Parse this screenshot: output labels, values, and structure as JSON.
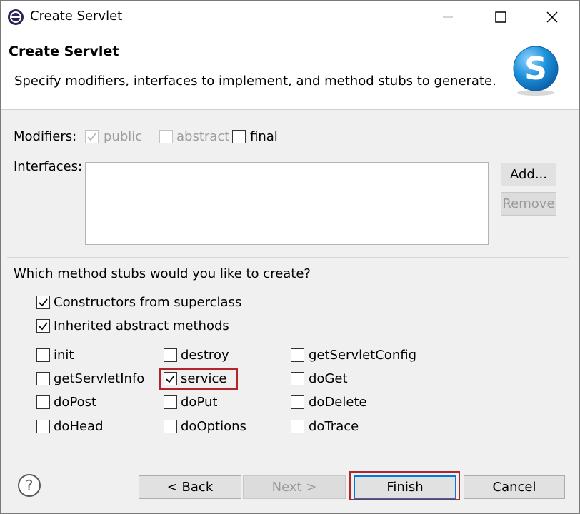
{
  "window": {
    "title": "Create Servlet"
  },
  "header": {
    "heading": "Create Servlet",
    "description": "Specify modifiers, interfaces to implement, and method stubs to generate."
  },
  "modifiers": {
    "label": "Modifiers:",
    "public": {
      "label": "public",
      "checked": true,
      "enabled": false
    },
    "abstract": {
      "label": "abstract",
      "checked": false,
      "enabled": false
    },
    "final": {
      "label": "final",
      "checked": false,
      "enabled": true
    }
  },
  "interfaces": {
    "label": "Interfaces:",
    "items": [],
    "add_label": "Add...",
    "remove_label": "Remove"
  },
  "stubs": {
    "question": "Which method stubs would you like to create?",
    "constructors": {
      "label": "Constructors from superclass",
      "checked": true
    },
    "inherited": {
      "label": "Inherited abstract methods",
      "checked": true
    },
    "methods": [
      {
        "label": "init",
        "checked": false
      },
      {
        "label": "destroy",
        "checked": false
      },
      {
        "label": "getServletConfig",
        "checked": false
      },
      {
        "label": "getServletInfo",
        "checked": false
      },
      {
        "label": "service",
        "checked": true
      },
      {
        "label": "doGet",
        "checked": false
      },
      {
        "label": "doPost",
        "checked": false
      },
      {
        "label": "doPut",
        "checked": false
      },
      {
        "label": "doDelete",
        "checked": false
      },
      {
        "label": "doHead",
        "checked": false
      },
      {
        "label": "doOptions",
        "checked": false
      },
      {
        "label": "doTrace",
        "checked": false
      }
    ]
  },
  "footer": {
    "back_label": "< Back",
    "next_label": "Next >",
    "finish_label": "Finish",
    "cancel_label": "Cancel"
  },
  "colors": {
    "highlight": "#b0262a",
    "focus": "#0078d7",
    "logo": "#1a8fd8"
  },
  "icons": [
    "eclipse-app-icon",
    "minimize-icon",
    "maximize-icon",
    "close-icon",
    "servlet-logo-icon",
    "help-icon",
    "checkmark-icon"
  ]
}
